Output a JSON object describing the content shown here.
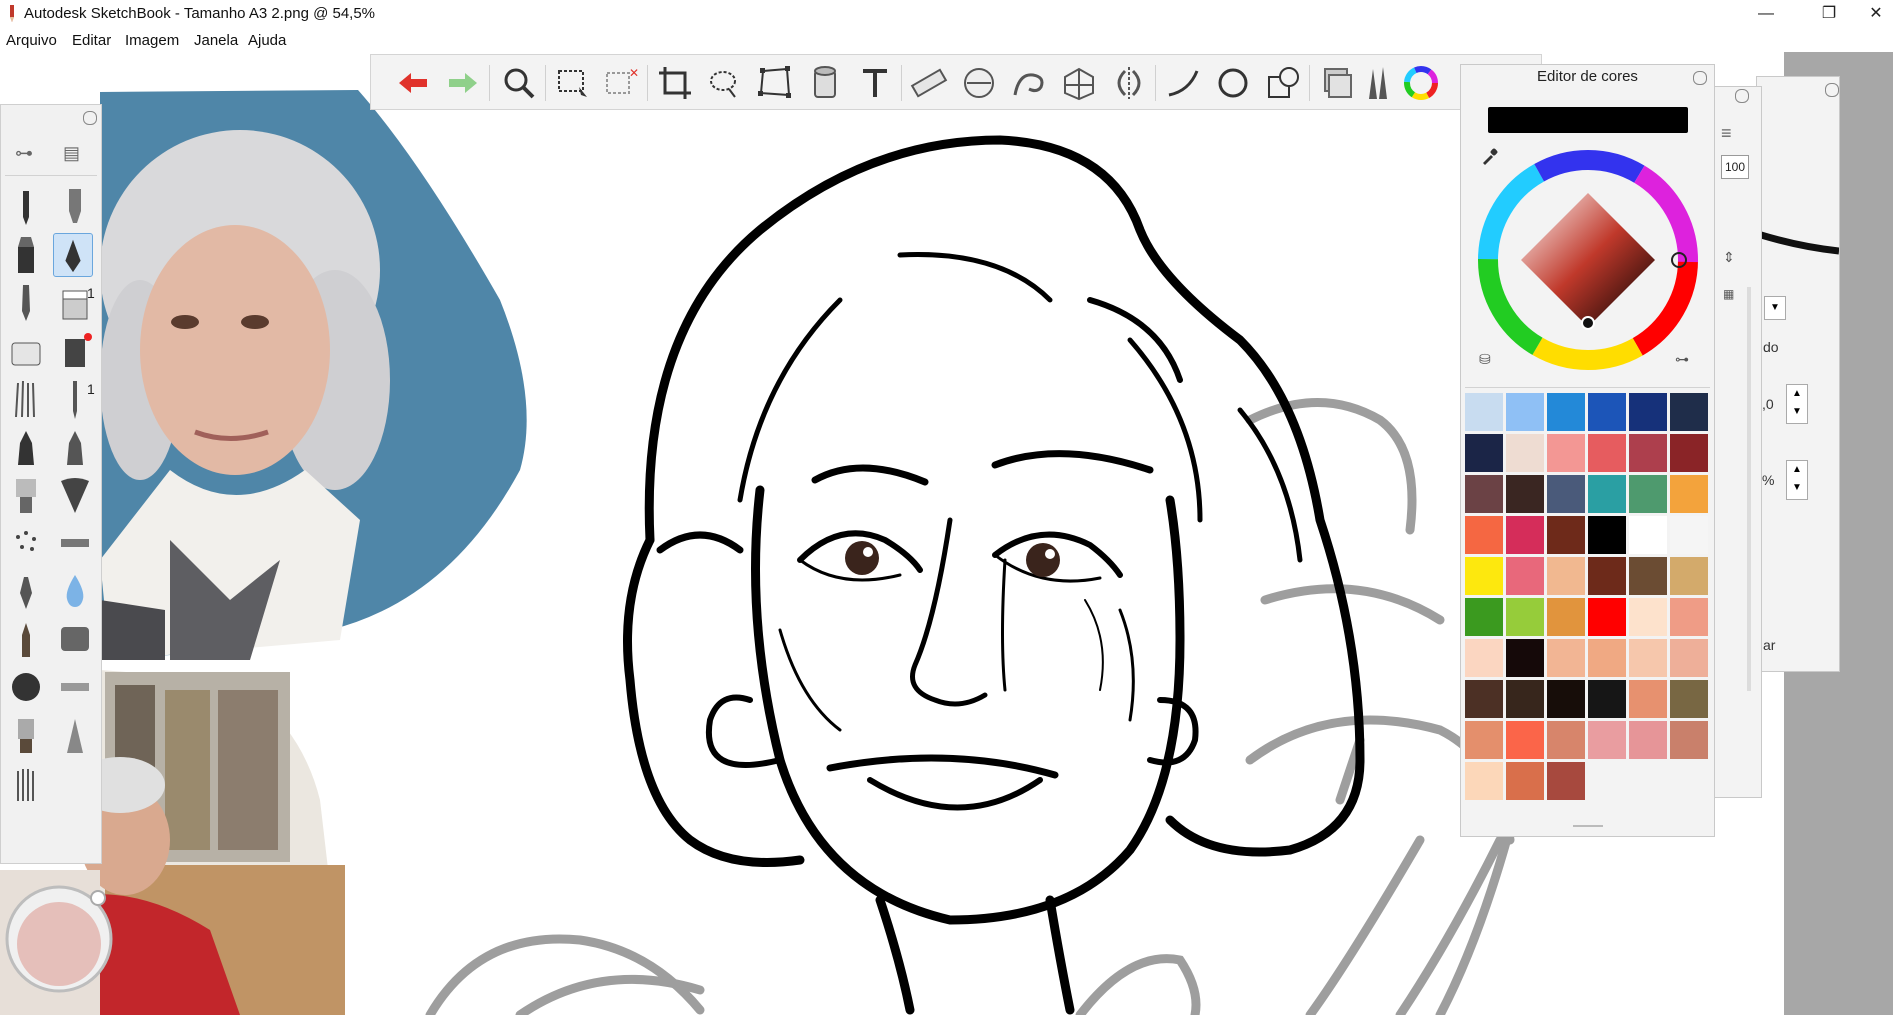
{
  "window": {
    "title": "Autodesk SketchBook - Tamanho A3 2.png @ 54,5%",
    "controls": {
      "minimize": "—",
      "maximize": "❐",
      "close": "✕"
    }
  },
  "menu": {
    "items": [
      "Arquivo",
      "Editar",
      "Imagem",
      "Janela",
      "Ajuda"
    ]
  },
  "toolbar": {
    "tools": [
      "undo-icon",
      "redo-icon",
      "zoom-icon",
      "rect-select-icon",
      "transform-select-icon",
      "crop-icon",
      "lasso-icon",
      "distort-icon",
      "fill-bucket-icon",
      "text-icon",
      "ruler-icon",
      "ellipse-guide-icon",
      "french-curve-icon",
      "perspective-icon",
      "symmetry-icon",
      "stroke-icon",
      "ellipse-icon",
      "shapes-icon",
      "layers-icon",
      "brush-library-icon",
      "color-wheel-icon"
    ]
  },
  "brush_palette": {
    "badges": [
      "1",
      "1"
    ]
  },
  "color_editor": {
    "title": "Editor de cores",
    "current_color": "#000000",
    "swatches": [
      "#c8dcf0",
      "#8fc0f5",
      "#2389d8",
      "#1c55b8",
      "#16317a",
      "#1f2d4a",
      "#1b2547",
      "#eedcd2",
      "#f39794",
      "#e65c5f",
      "#ad3f4d",
      "#8a2427",
      "#6b4245",
      "#3a2622",
      "#4a5a7a",
      "#2a9fa3",
      "#4e9a6e",
      "#f3a33c",
      "#f56742",
      "#d52d5a",
      "#6e2a1a",
      "#000000",
      "#ffffff",
      "#f5f5f5",
      "#fde80e",
      "#e8687b",
      "#f1b890",
      "#6d2a1a",
      "#6b4c33",
      "#d3aa6b",
      "#3b9a1f",
      "#96cc3a",
      "#e1943d",
      "#ff0000",
      "#fde2cc",
      "#ef9c86",
      "#fbd6c1",
      "#150909",
      "#f2b594",
      "#f0a983",
      "#f6c7ac",
      "#eeaf99",
      "#4c3025",
      "#37261c",
      "#170d09",
      "#161616",
      "#e7916f",
      "#786743",
      "#e48f6c",
      "#fb6549",
      "#d7856b",
      "#e99da0",
      "#e69598",
      "#c9806b",
      "#fcd7b9",
      "#d96f4b",
      "#a7493e"
    ]
  },
  "side_panels": {
    "opacity_value": "100",
    "layer_blend": "do",
    "value_1": ",0",
    "value_2": "%",
    "label_bottom": "ar"
  }
}
